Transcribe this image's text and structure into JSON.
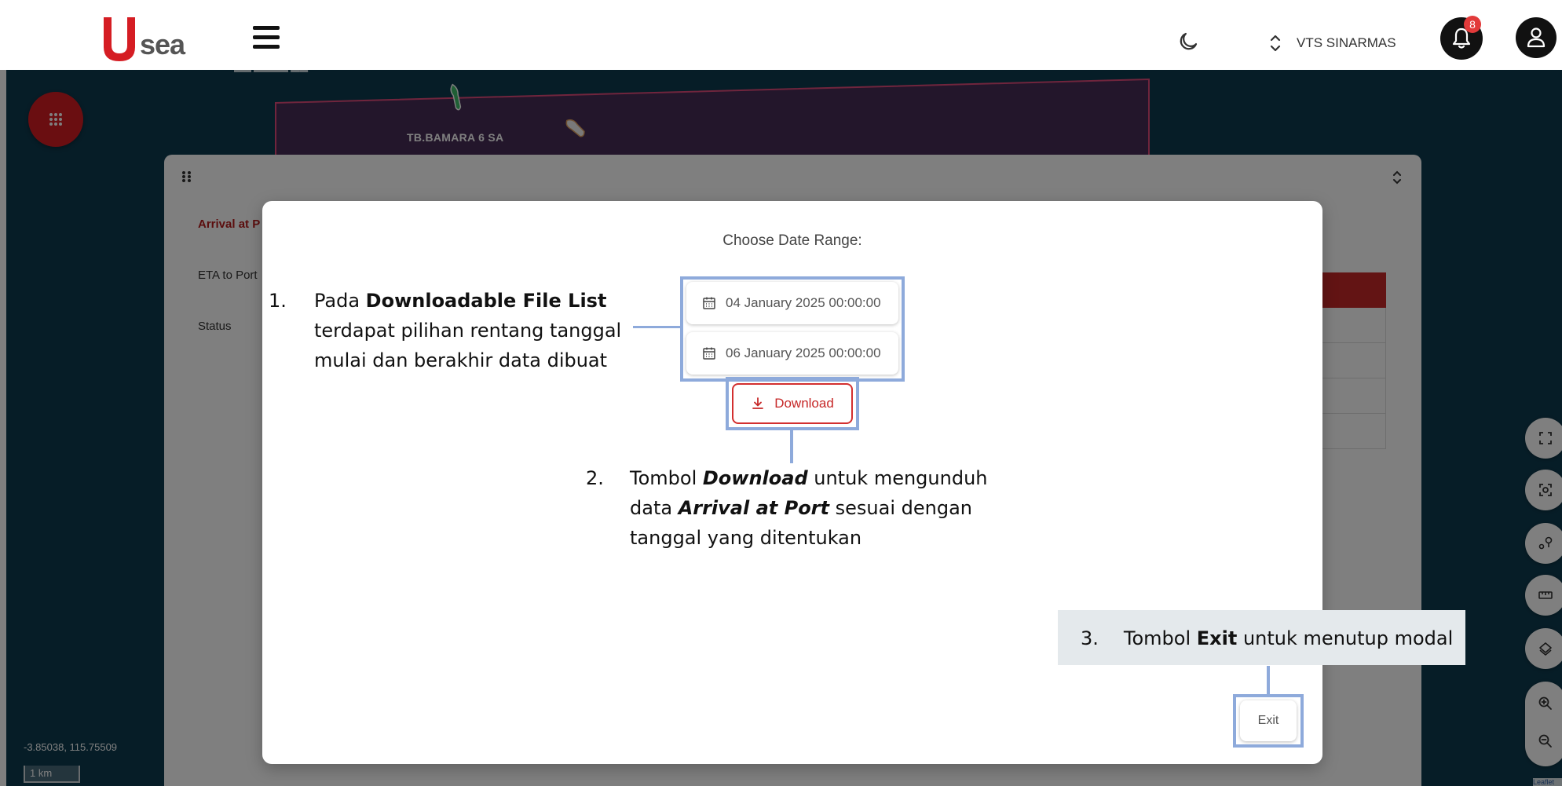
{
  "header": {
    "logo_text": "sea",
    "org_name": "VTS SINARMAS",
    "notification_count": "8"
  },
  "map": {
    "top_partial_label": "▬▬ ▬▬▬▬ ▬▬",
    "ship_label": "TB.BAMARA 6 SA",
    "coordinates": "-3.85038, 115.75509",
    "scale": "1 km",
    "attribution": "Leaflet"
  },
  "panel": {
    "arrival_label": "Arrival at P",
    "eta_label": "ETA to Port",
    "status_label": "Status"
  },
  "modal": {
    "title": "Choose Date Range:",
    "start_date": "04 January 2025 00:00:00",
    "end_date": "06 January 2025 00:00:00",
    "download_label": "Download",
    "exit_label": "Exit"
  },
  "annotations": {
    "note1": {
      "number": "1.",
      "pre": "Pada ",
      "bold": "Downloadable File List",
      "line2": "terdapat pilihan rentang tanggal",
      "line3": "mulai dan berakhir data dibuat"
    },
    "note2": {
      "number": "2.",
      "pre": "Tombol ",
      "bold": "Download",
      "post": " untuk mengunduh",
      "line2_pre": "data ",
      "line2_bold": "Arrival at Port",
      "line2_post": " sesuai dengan",
      "line3": "tanggal yang ditentukan"
    },
    "note3": {
      "number": "3.",
      "pre": "Tombol ",
      "bold": "Exit",
      "post": " untuk menutup modal"
    }
  },
  "colors": {
    "brand_red": "#d51d23",
    "map_bg": "#0d3a4e",
    "highlight": "#8eaadb"
  }
}
